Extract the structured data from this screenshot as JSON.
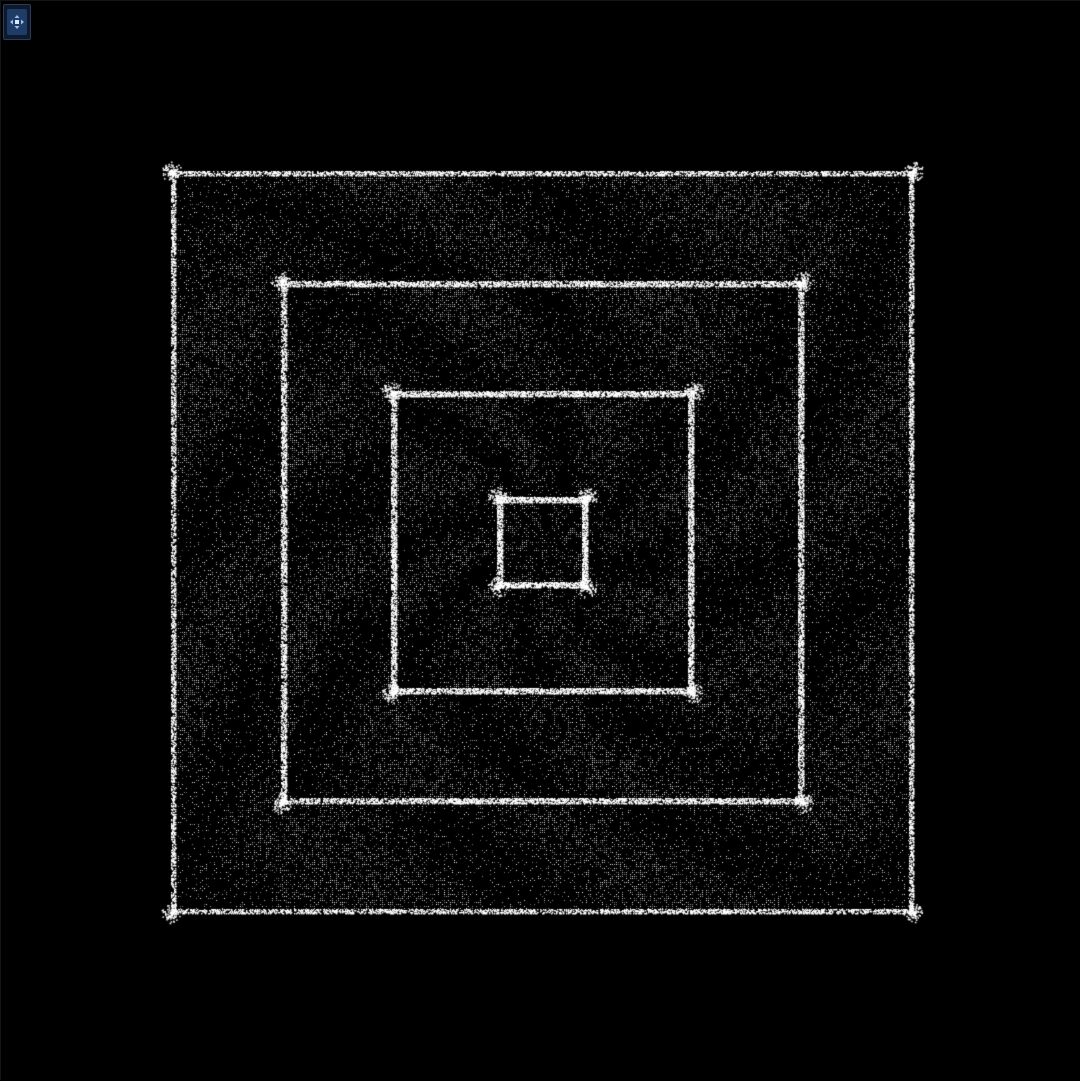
{
  "canvas": {
    "background": "#000000",
    "dot_color": "#ffffff",
    "pattern": "concentric-square-fractal-dots"
  },
  "toolbar": {
    "corner_button_icon": "move-icon",
    "corner_button_color": "#1e3c66"
  }
}
